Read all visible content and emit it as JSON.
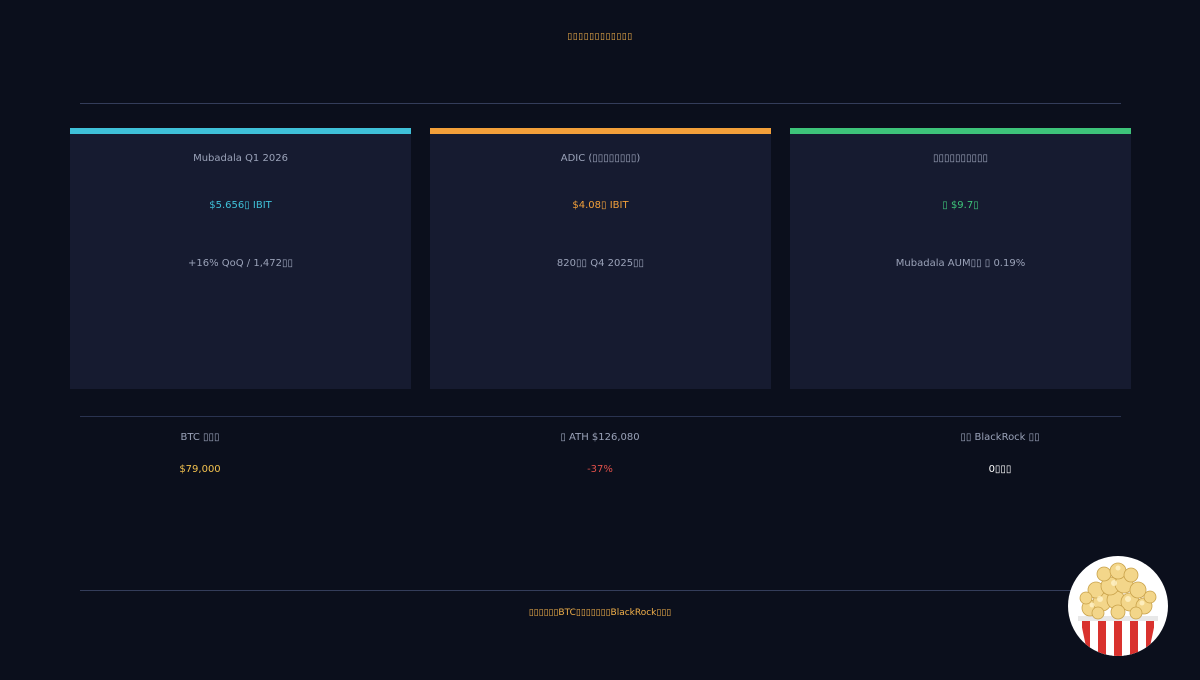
{
  "header": {
    "title": "▯▯▯▯▯▯▯▯▯▯▯▯"
  },
  "colors": {
    "accent_cyan": "#3fc1d9",
    "accent_orange": "#f3a03a",
    "accent_green": "#3ec47a",
    "accent_yellow": "#f2c14e",
    "negative_red": "#e0504a",
    "neutral_white": "#ffffff"
  },
  "cards": [
    {
      "label": "Mubadala Q1 2026",
      "value": "$5.656▯ IBIT",
      "sub": "+16% QoQ / 1,472▯▯"
    },
    {
      "label": "ADIC (▯▯▯▯▯▯▯▯)",
      "value": "$4.08▯ IBIT",
      "sub": "820▯▯ Q4 2025▯▯"
    },
    {
      "label": "▯▯▯▯▯▯▯▯▯▯",
      "value": "▯ $9.7▯",
      "sub": "Mubadala AUM▯▯ ▯ 0.19%"
    }
  ],
  "stats": [
    {
      "label": "BTC ▯▯▯",
      "value": "$79,000"
    },
    {
      "label": "▯ ATH $126,080",
      "value": "-37%"
    },
    {
      "label": "▯▯ BlackRock ▯▯",
      "value": "0▯▯▯"
    }
  ],
  "footer": {
    "text": "▯▯▯▯▯▯BTC▯▯▯▯▯▯▯BlackRock▯▯▯"
  },
  "icons": {
    "avatar": "popcorn-icon"
  }
}
